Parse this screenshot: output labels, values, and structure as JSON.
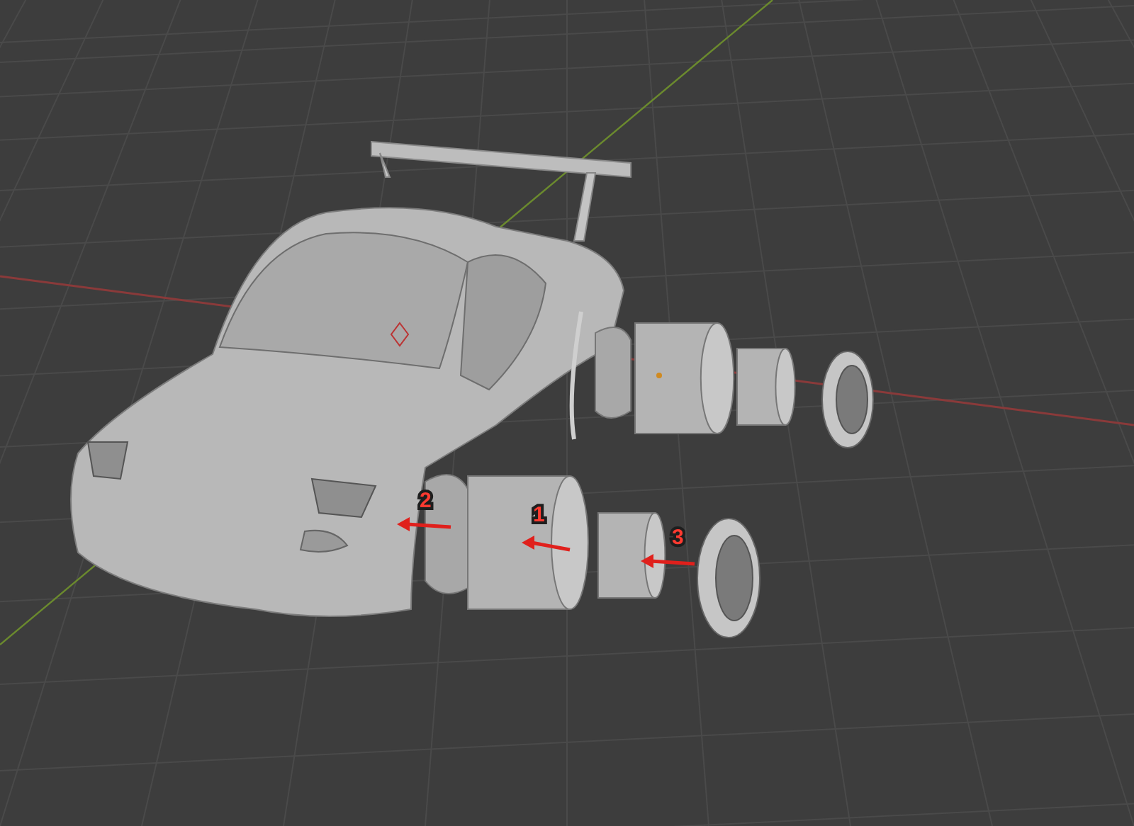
{
  "viewport": {
    "annotations": [
      {
        "label": "1"
      },
      {
        "label": "2"
      },
      {
        "label": "3"
      }
    ]
  }
}
